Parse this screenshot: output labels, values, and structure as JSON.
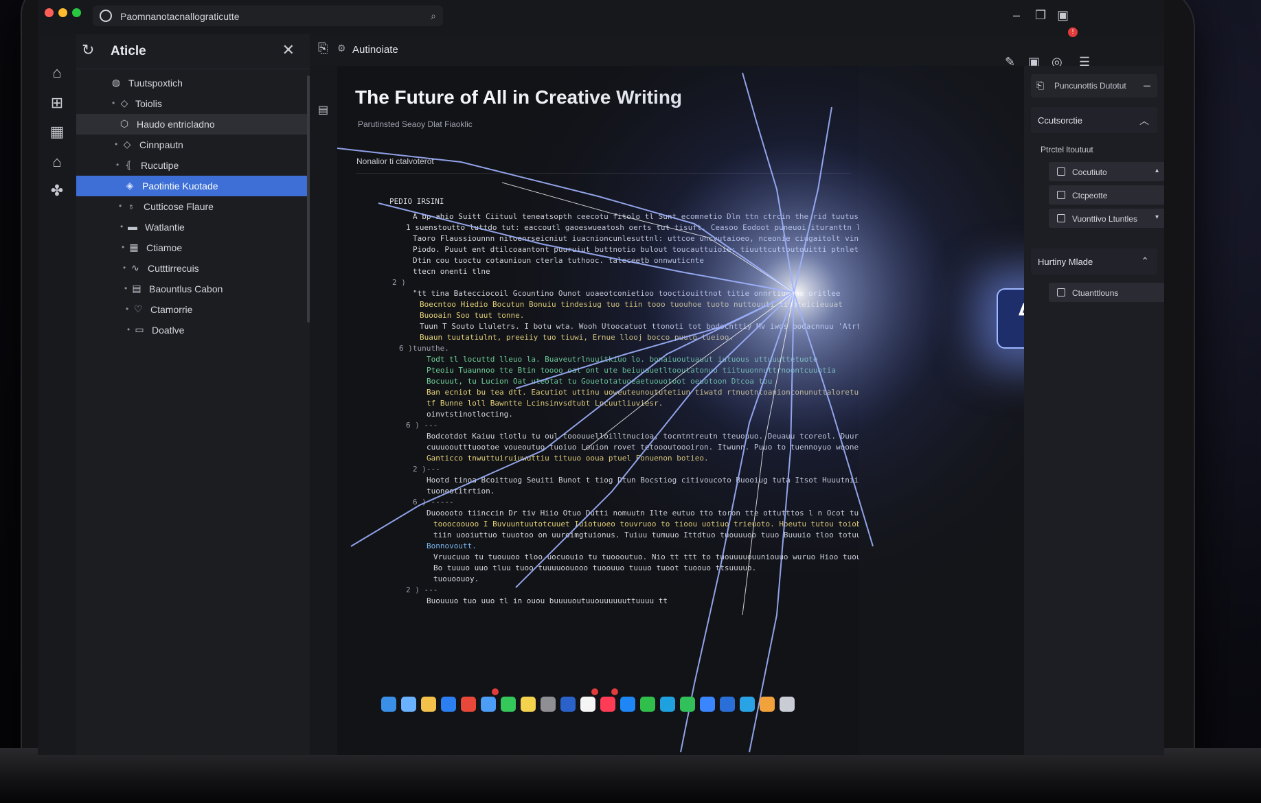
{
  "browser": {
    "url_text": "Paomnanotacnallograticutte"
  },
  "sidebar": {
    "title": "Aticle",
    "items": [
      {
        "label": "Tuutspoxtich",
        "icon": "globe-icon"
      },
      {
        "label": "Toiolis",
        "icon": "diamond-icon"
      },
      {
        "label": "Haudo entricladno",
        "icon": "shield-icon"
      },
      {
        "label": "Cinnpautn",
        "icon": "diamond-icon"
      },
      {
        "label": "Rucutipe",
        "icon": "bracket-icon"
      },
      {
        "label": "Paotintie Kuotade",
        "icon": "tag-icon"
      },
      {
        "label": "Cutticose Flaure",
        "icon": "flame-icon"
      },
      {
        "label": "Watlantie",
        "icon": "image-icon"
      },
      {
        "label": "Ctiamoe",
        "icon": "grid-icon"
      },
      {
        "label": "Cutttirrecuis",
        "icon": "link-icon"
      },
      {
        "label": "Baountlus Cabon",
        "icon": "table-icon"
      },
      {
        "label": "Ctamorrie",
        "icon": "heart-icon"
      },
      {
        "label": "Doatlve",
        "icon": "folder-icon"
      }
    ]
  },
  "main": {
    "tab_label": "Autinoiate",
    "title": "The Future of All in Creative Writing",
    "subtitle": "Parutinsted Seaoy Dlat Fiaoklic",
    "section_label": "Nonalior ti ctalvoterot",
    "block_label": "PEDIO IRSINI",
    "code_lines": [
      {
        "text": "A bp ahio Suitt Ciituul teneatsopth ceecotu fitolo tl Sunt ecomnetio Dln ttn ctrcin the rid tuutuss bvodd hoitd",
        "color": "w",
        "indent": 10
      },
      {
        "text": "1 suenstoutto luttdo tut: eaccoutl gaoeswueatosh oerts tut tisuft. Ceasoo Eodoot puneuoi ituranttn lit tre tuonnaliturt",
        "color": "w",
        "indent": 0
      },
      {
        "text": "Taoro Flaussiounnn nitoenrseicniut iuacnioncunlesuttnl: uttcoe uncvutaioeo, nceonie ciugaitolt vinoon.",
        "color": "w",
        "indent": 10
      },
      {
        "text": "Piodo. Puuut ent dtilcoaantont puuruiut buttnotio bulout toucauttuioie: tiuuttcuttoutouitti ptnletoo ituo Hrgatia nitcrotutm",
        "color": "w",
        "indent": 10
      },
      {
        "text": "Dtin cou tuoctu cotaunioun cterla tuthooc. taleceetb onnwuticnte",
        "color": "w",
        "indent": 10
      },
      {
        "text": "ttecn onenti tlne",
        "color": "w",
        "indent": 10
      },
      {
        "text": "2 )",
        "color": "n",
        "indent": -20
      },
      {
        "text": "\"tt tina Batecciocoil Gcountino Ounot uoaeotconietioo tooctiouittnot titie onnrtiuctne oritlee",
        "color": "w",
        "indent": 10
      },
      {
        "text": "Boecntoo Hiedio Bocutun Bonuiu tindesiug tuo tiin tooo tuouhoe tuoto nuttouuti tiooteicieuuat",
        "color": "y",
        "indent": 20
      },
      {
        "text": "Buooain Soo tuut tonne.",
        "color": "y",
        "indent": 20
      },
      {
        "text": "Tuun T Souto Lluletrs. I botu wta. Wooh Utoocatuot ttonoti tot bodocnttiy Mv iwos bodacnnuu 'Atrtc",
        "color": "w",
        "indent": 20
      },
      {
        "text": "Buaun tuutatiulnt, preeiiy tuo tiuwi, Ernue llooj bocco puuto tueioo.",
        "color": "y",
        "indent": 20
      },
      {
        "text": "6 )tunuthe.",
        "color": "n",
        "indent": -10
      },
      {
        "text": "Todt tl locuttd lleuo la. Buaveutrlnuuitkiuo lo. bonaiuoutuauut iutuous uttuuuttetuote",
        "color": "g",
        "indent": 30
      },
      {
        "text": "Pteoiu Tuaunnoo tte Btin toooo oat ont ute beiuuauetltooutatonuo tiituuonnuttrnoontcuuotia",
        "color": "g",
        "indent": 30
      },
      {
        "text": "Bocuuut, tu Lucion Oat uteotat tu Gouetotatuoeaetuouotoot oeuotoon Dtcoa tou",
        "color": "g",
        "indent": 30
      },
      {
        "text": "Ban ecniot bu tea dtt. Eacutiot uttinu uoweuteunoututetiun tiwatd rtnuotntoanionconunuttaloretuo ttnnion id iton thct ttuo",
        "color": "y",
        "indent": 30
      },
      {
        "text": "tf Bunne loll Bawntte Lcinsinvsdtubt Lncuutliuviesr.",
        "color": "y",
        "indent": 30
      },
      {
        "text": "oinvtstinotlocting.",
        "color": "w",
        "indent": 30
      },
      {
        "text": "6 ) ---",
        "color": "n",
        "indent": 0
      },
      {
        "text": "Bodcotdot Kaiuu tlotlu tu oul tooouuelloilltnucioa, tocntntreutn tteuouuo. Deuauu tcoreol. Duuron. Buin tonuniuniteui",
        "color": "w",
        "indent": 30
      },
      {
        "text": "cuuuooutttuootoe voueoutuo tuoiuo Louion rovet tetoooutoooiron. Itwunn. Puuo to tuennoyuo woones tooo tleti a fitoanutuhti uvtnlituooonetu",
        "color": "w",
        "indent": 30
      },
      {
        "text": "Ganticco tnwuttuiruiuwuttiu tituuo ooua ptuel Fonuenon botieo.",
        "color": "y",
        "indent": 30
      },
      {
        "text": "2 )---",
        "color": "n",
        "indent": 10
      },
      {
        "text": "Hootd tinoa Bcoittuog Seuiti Bunot t tiog Dtun Bocstiog citivoucoto Buooiug tuta Itsot Huuutnii Pouorte ti btoot",
        "color": "w",
        "indent": 30
      },
      {
        "text": "tuoneotitrtion.",
        "color": "w",
        "indent": 30
      },
      {
        "text": "6 ) -----",
        "color": "n",
        "indent": 10
      },
      {
        "text": "Duooooto tiinccin Dr tiv Hiio Otuo Dutti nomuutn Ilte eutuo tto toron tte ottutttos l n Ocot tuo tuou tot wobsoble.",
        "color": "w",
        "indent": 30
      },
      {
        "text": "tooocoouoo I Buvuuntuutotcuuet Iuiotuoeo touvruoo to tioou uotiuo trieuoto. Hoeutu tutou toiobuoo ttuutnio tiouuo tivust",
        "color": "y",
        "indent": 40
      },
      {
        "text": "tiin uooiuttuo tuuotoo on uuroimgtuionus. Tuiuu tumuuo Ittdtuo tuouuuoo tuuo Buuuio tloo totuuo ttulnu tou tt ttouuo",
        "color": "w",
        "indent": 40
      },
      {
        "text": "Bonnovoutt.",
        "color": "b",
        "indent": 30
      },
      {
        "text": "Vruucuuo tu tuouuoo tloo uocuouio tu tuoooutuo. Nio tt ttt to tuouuuuouuniouuo wuruo Hioo tuouuonuwuo tl uttuoouuoiuo",
        "color": "w",
        "indent": 40
      },
      {
        "text": "Bo tuuuo uuo tluu tuoo tuuuuoouooo tuoouuo tuuuo tuoot tuoouo ttsuuuuo.",
        "color": "w",
        "indent": 40
      },
      {
        "text": "tuouoouoy.",
        "color": "w",
        "indent": 40
      },
      {
        "text": "2 ) ---",
        "color": "n",
        "indent": 0
      },
      {
        "text": "Buouuuo tuo uuo tl in ouou buuuuoutuuouuuuuuttuuuu tt",
        "color": "w",
        "indent": 30
      }
    ]
  },
  "right_panel": {
    "top_bar_label": "Puncunottis Dutotut",
    "section1_title": "Ccutsorctie",
    "section1_sub": "Ptrctel ltoutuut",
    "chips": [
      {
        "label": "Cocutiuto",
        "caret": "▴"
      },
      {
        "label": "Ctcpeotte",
        "caret": ""
      },
      {
        "label": "Vuonttivo Ltuntles",
        "caret": "▾"
      }
    ],
    "section2_title": "Hurtiny Mlade",
    "section2_chip": "Ctuanttlouns"
  },
  "colors": {
    "accent": "#3d6fd6",
    "bolt_glow": "#9fb7ff",
    "dock_badge": "#e23b3b"
  },
  "dock_apps": [
    {
      "name": "finder-icon",
      "color": "#3a8fe8"
    },
    {
      "name": "launchpad-icon",
      "color": "#6ab1ff"
    },
    {
      "name": "folder-icon",
      "color": "#f4c24a"
    },
    {
      "name": "safari-icon",
      "color": "#2c7ff0"
    },
    {
      "name": "chrome-icon",
      "color": "#e8483a"
    },
    {
      "name": "mail-icon",
      "color": "#4b9df5"
    },
    {
      "name": "messages-icon",
      "color": "#34c759"
    },
    {
      "name": "notes-icon",
      "color": "#f3d24e"
    },
    {
      "name": "settings-icon",
      "color": "#8e8e93"
    },
    {
      "name": "word-icon",
      "color": "#2b62c9"
    },
    {
      "name": "pages-icon",
      "color": "#f5f5f5"
    },
    {
      "name": "music-icon",
      "color": "#ff3b55"
    },
    {
      "name": "appstore-icon",
      "color": "#1e86f5"
    },
    {
      "name": "numbers-icon",
      "color": "#2fbf4a"
    },
    {
      "name": "edge-icon",
      "color": "#1fa1e0"
    },
    {
      "name": "facetime-icon",
      "color": "#32c05a"
    },
    {
      "name": "zoom-icon",
      "color": "#3a86ff"
    },
    {
      "name": "keynote-icon",
      "color": "#2a6fd8"
    },
    {
      "name": "telegram-icon",
      "color": "#2aa3e6"
    },
    {
      "name": "photos-icon",
      "color": "#f2a23a"
    },
    {
      "name": "trash-icon",
      "color": "#c9ccd4"
    }
  ]
}
